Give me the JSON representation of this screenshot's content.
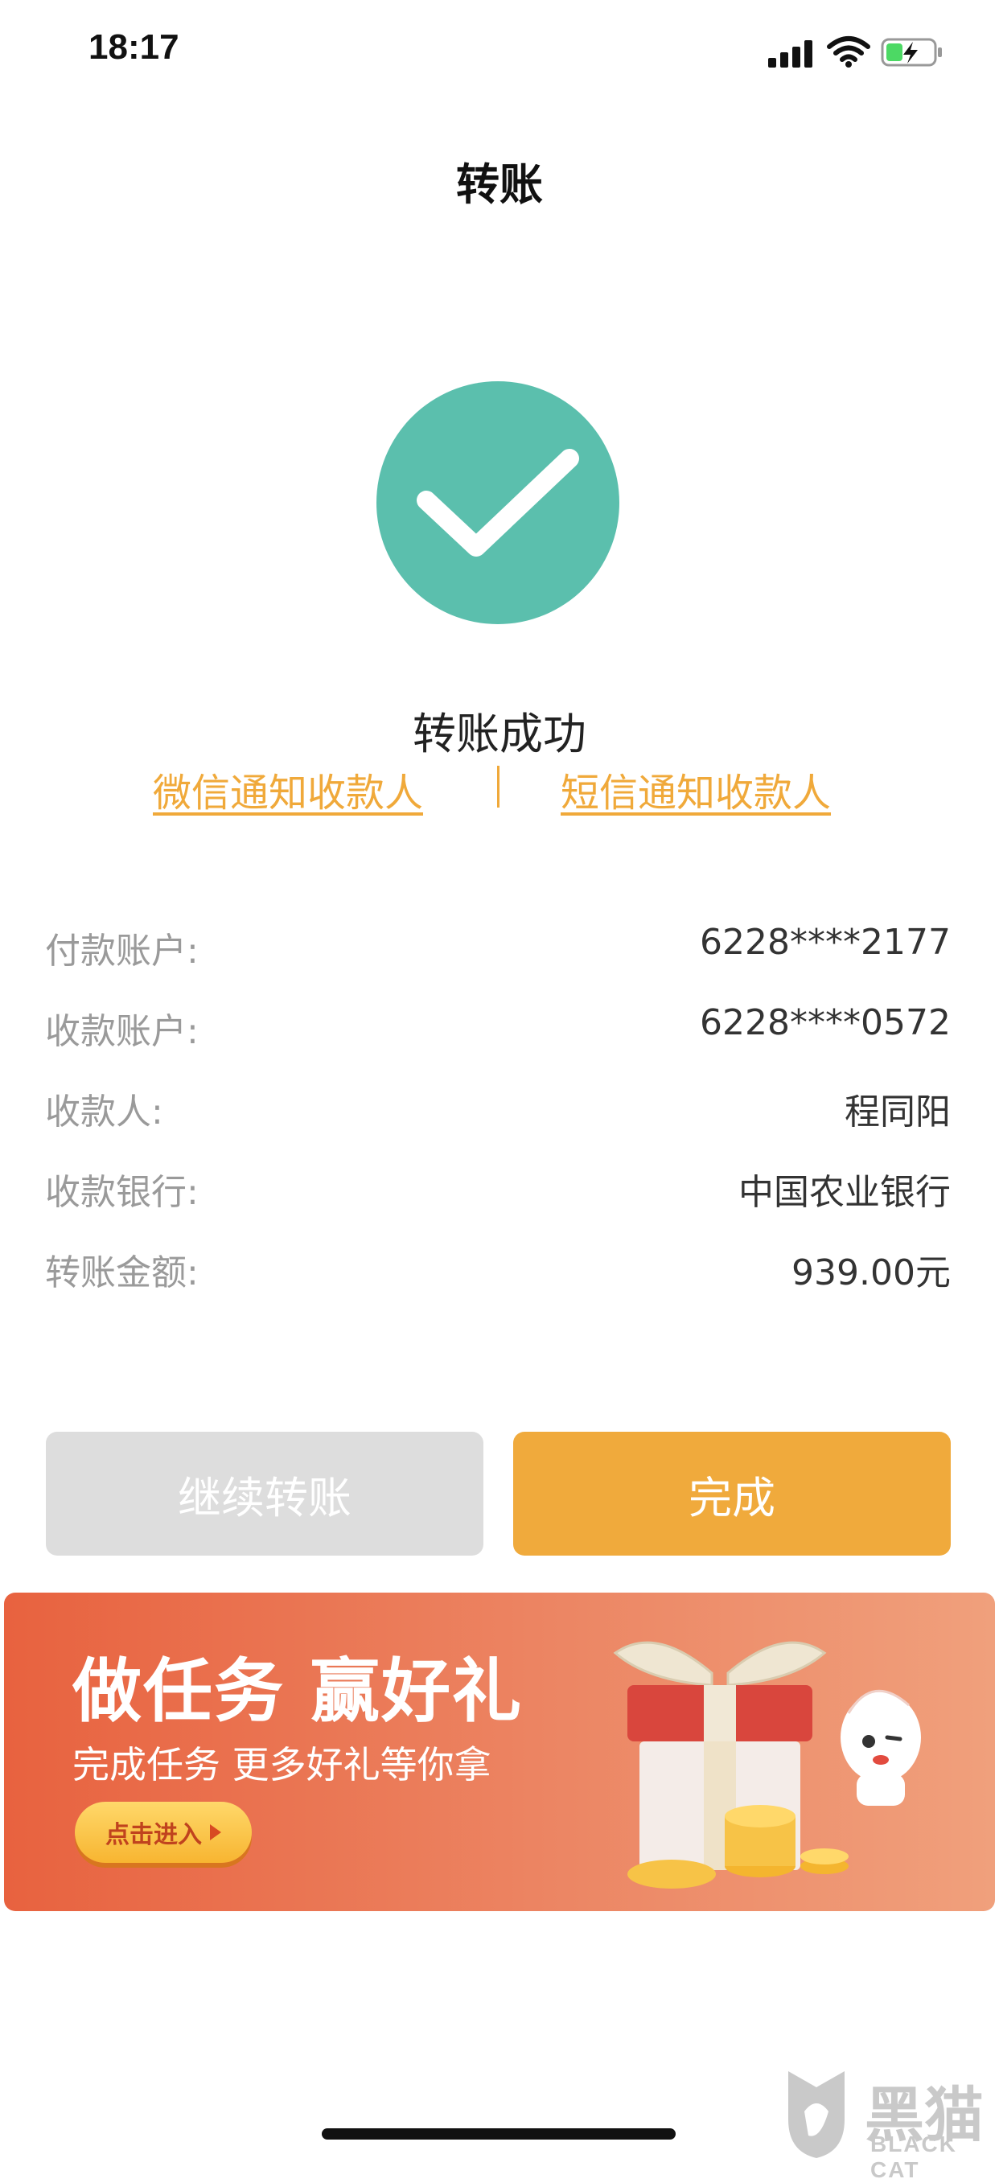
{
  "status_bar": {
    "time": "18:17"
  },
  "nav": {
    "title": "转账"
  },
  "result": {
    "message": "转账成功",
    "notify_wechat": "微信通知收款人",
    "notify_sms": "短信通知收款人"
  },
  "details": [
    {
      "label": "付款账户:",
      "value": "6228****2177"
    },
    {
      "label": "收款账户:",
      "value": "6228****0572"
    },
    {
      "label": "收款人:",
      "value": "程同阳"
    },
    {
      "label": "收款银行:",
      "value": "中国农业银行"
    },
    {
      "label": "转账金额:",
      "value": "939.00元"
    }
  ],
  "actions": {
    "continue_label": "继续转账",
    "done_label": "完成"
  },
  "banner": {
    "title": "做任务 赢好礼",
    "subtitle": "完成任务 更多好礼等你拿",
    "button_label": "点击进入"
  },
  "watermark": {
    "cn": "黑猫",
    "en": "BLACK CAT"
  },
  "colors": {
    "success_green": "#5bbfad",
    "accent_orange": "#f0aa3c",
    "link_orange": "#f0a93a",
    "banner_red": "#e8623f"
  },
  "icons": {
    "status": [
      "signal-icon",
      "wifi-icon",
      "battery-charging-icon"
    ],
    "success": "check-circle-icon",
    "banner_art": "gift-box-icon"
  }
}
